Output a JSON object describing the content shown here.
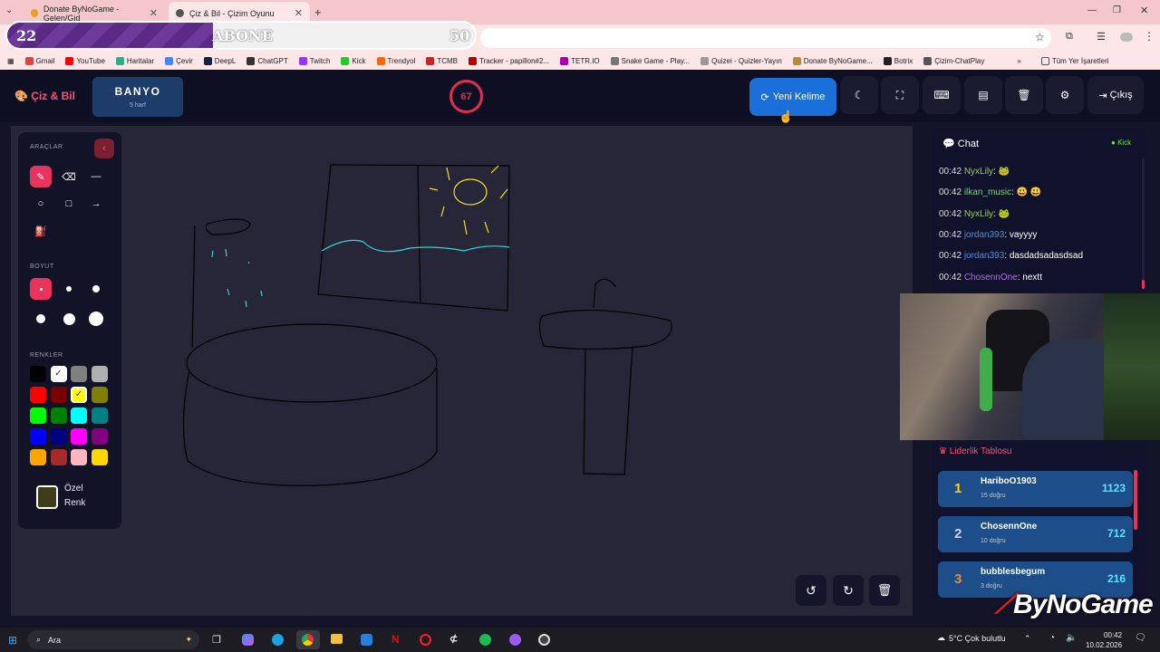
{
  "browser": {
    "tabs": [
      {
        "label": "Donate ByNoGame - Gelen/Gid"
      },
      {
        "label": "Çiz & Bil - Çizim Oyunu"
      }
    ],
    "bookmarks": [
      "Gmail",
      "YouTube",
      "Haritalar",
      "Çevir",
      "DeepL",
      "ChatGPT",
      "Twitch",
      "Kick",
      "Trendyol",
      "TCMB",
      "Tracker - papillon#2...",
      "TETR.IO",
      "Snake Game - Play...",
      "Quizei - Quizler-Yayın",
      "Donate ByNoGame...",
      "Botrix",
      "Çizim-ChatPlay"
    ],
    "all_bookmarks": "Tüm Yer İşaretleri"
  },
  "sub_goal": {
    "current": "22",
    "label": "ABONE",
    "target": "50",
    "progress": 0.44
  },
  "app": {
    "logo": "Çiz & Bil",
    "word": "BANYO",
    "word_hint": "5 harf",
    "timer": "67",
    "new_word": "Yeni Kelime",
    "exit": "Çıkış"
  },
  "tools": {
    "tools_title": "ARAÇLAR",
    "size_title": "BOYUT",
    "colors_title": "RENKLER",
    "custom_color": "Özel Renk",
    "colors": [
      "#000000",
      "#ffffff",
      "#808080",
      "#b0b0b0",
      "#ff0000",
      "#7a0000",
      "#ffff00",
      "#808000",
      "#00ff00",
      "#008000",
      "#00ffff",
      "#008080",
      "#0000ff",
      "#000080",
      "#ff00ff",
      "#800080",
      "#ffa500",
      "#a52a2a",
      "#ffb6c1",
      "#ffd700"
    ],
    "custom_swatch": "#3d3d1c"
  },
  "chat": {
    "title": "Chat",
    "platform": "Kick",
    "messages": [
      {
        "time": "00:42",
        "user": "NyxLily",
        "color": "#9bd35a",
        "text": "🐸"
      },
      {
        "time": "00:42",
        "user": "ilkan_music",
        "color": "#7bd67b",
        "text": "😃 😃"
      },
      {
        "time": "00:42",
        "user": "NyxLily",
        "color": "#9bd35a",
        "text": "🐸"
      },
      {
        "time": "00:42",
        "user": "jordan393",
        "color": "#4f8fd8",
        "text": "vayyyy"
      },
      {
        "time": "00:42",
        "user": "jordan393",
        "color": "#4f8fd8",
        "text": "dasdadsadasdsad"
      },
      {
        "time": "00:42",
        "user": "ChosennOne",
        "color": "#b070e0",
        "text": "nextt"
      }
    ]
  },
  "leaderboard": {
    "title": "Liderlik Tablosu",
    "rows": [
      {
        "rank": "1",
        "name": "HariboO1903",
        "sub": "15 doğru",
        "score": "1123",
        "rank_color": "#ffd400"
      },
      {
        "rank": "2",
        "name": "ChosennOne",
        "sub": "10 doğru",
        "score": "712",
        "rank_color": "#d0d0e0"
      },
      {
        "rank": "3",
        "name": "bubblesbegum",
        "sub": "3 doğru",
        "score": "216",
        "rank_color": "#e08a3a"
      }
    ]
  },
  "watermark": "ByNoGame",
  "taskbar": {
    "search": "Ara",
    "weather": "5°C  Çok bulutlu",
    "time": "00:42",
    "date": "10.02.2026"
  }
}
